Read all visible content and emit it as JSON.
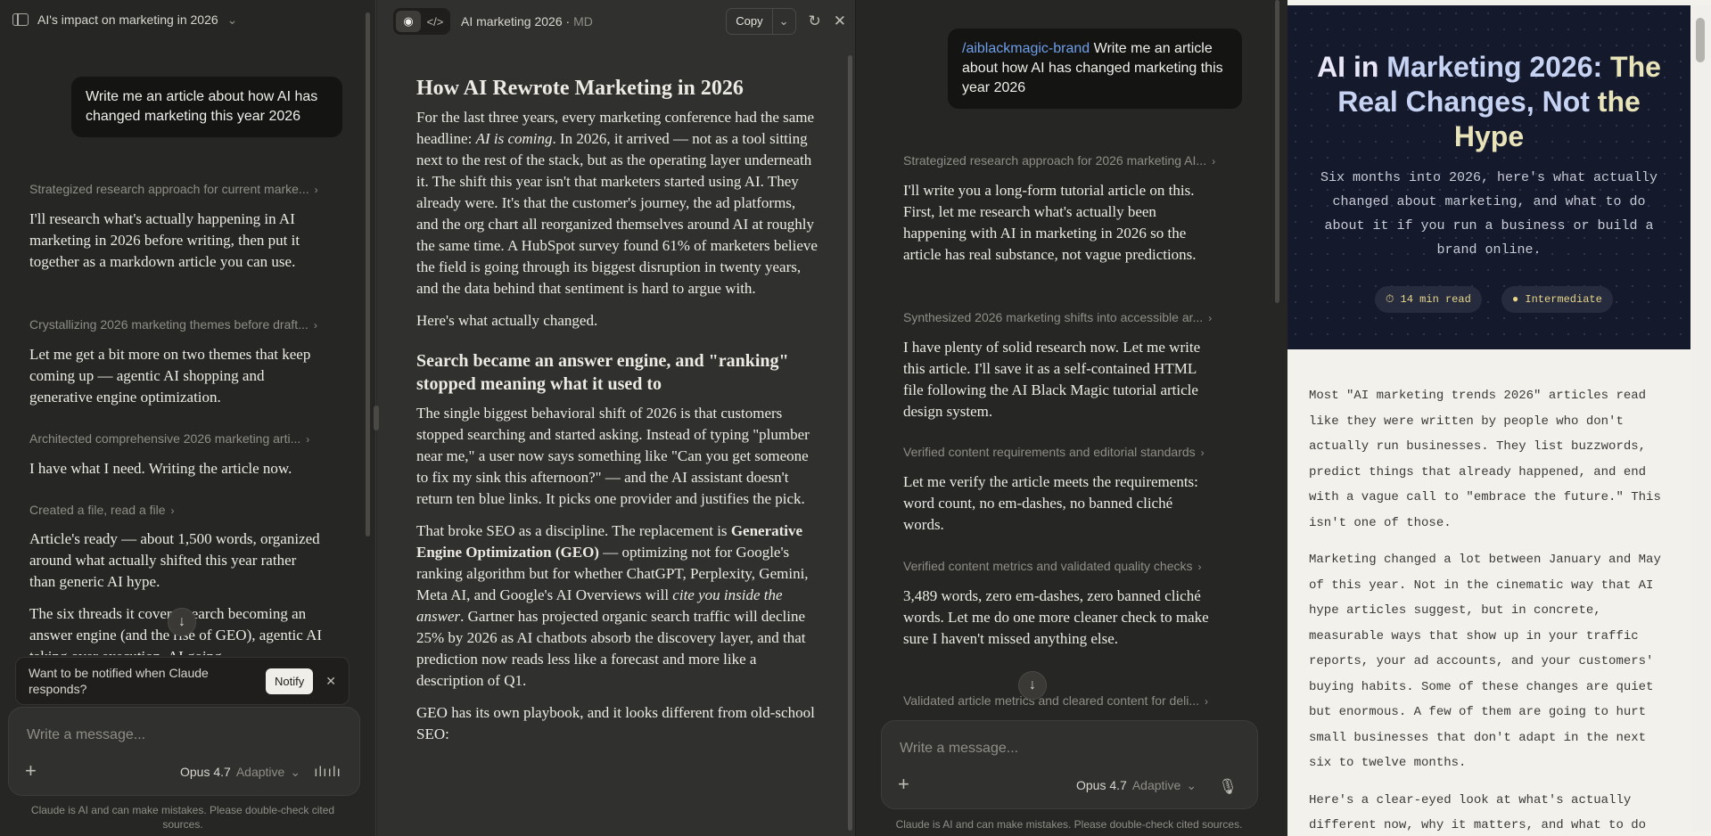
{
  "pane1": {
    "chat_title": "AI's impact on marketing in 2026",
    "user_message": "Write me an article about how AI has changed marketing this year 2026",
    "thoughts": [
      "Strategized research approach for current marke...",
      "Crystallizing 2026 marketing themes before draft...",
      "Architected comprehensive 2026 marketing arti...",
      "Created a file, read a file"
    ],
    "replies": [
      "I'll research what's actually happening in AI marketing in 2026 before writing, then put it together as a markdown article you can use.",
      "Let me get a bit more on two themes that keep coming up — agentic AI shopping and generative engine optimization.",
      "I have what I need. Writing the article now.",
      "Article's ready — about 1,500 words, organized around what actually shifted this year rather than generic AI hype.",
      "The six threads it covers: search becoming an answer engine (and the rise of GEO), agentic AI taking over execution, AI going"
    ],
    "notify_text": "Want to be notified when Claude responds?",
    "notify_button": "Notify",
    "composer_placeholder": "Write a message...",
    "model_name": "Opus 4.7",
    "model_mode": "Adaptive",
    "disclaimer": "Claude is AI and can make mistakes. Please double-check cited sources."
  },
  "pane2": {
    "file_name": "AI marketing 2026",
    "file_type": "MD",
    "copy_label": "Copy",
    "title": "How AI Rewrote Marketing in 2026",
    "para1_a": "For the last three years, every marketing conference had the same headline: ",
    "para1_em": "AI is coming",
    "para1_b": ". In 2026, it arrived — not as a tool sitting next to the rest of the stack, but as the operating layer underneath it. The shift this year isn't that marketers started using AI. They already were. It's that the customer's journey, the ad platforms, and the org chart all reorganized themselves around AI at roughly the same time. A HubSpot survey found 61% of marketers believe the field is going through its biggest disruption in twenty years, and the data behind that sentiment is hard to argue with.",
    "para2": "Here's what actually changed.",
    "h2": "Search became an answer engine, and \"ranking\" stopped meaning what it used to",
    "para3": "The single biggest behavioral shift of 2026 is that customers stopped searching and started asking. Instead of typing \"plumber near me,\" a user now says something like \"Can you get someone to fix my sink this afternoon?\" — and the AI assistant doesn't return ten blue links. It picks one provider and justifies the pick.",
    "para4_a": "That broke SEO as a discipline. The replacement is ",
    "para4_strong": "Generative Engine Optimization (GEO)",
    "para4_b": " — optimizing not for Google's ranking algorithm but for whether ChatGPT, Perplexity, Gemini, Meta AI, and Google's AI Overviews will ",
    "para4_em": "cite you inside the answer",
    "para4_c": ". Gartner has projected organic search traffic will decline 25% by 2026 as AI chatbots absorb the discovery layer, and that prediction now reads less like a forecast and more like a description of Q1.",
    "para5": "GEO has its own playbook, and it looks different from old-school SEO:"
  },
  "pane3": {
    "slash_command": "/aiblackmagic-brand",
    "user_message": "Write me an article about how AI has changed marketing this year 2026",
    "thoughts": [
      "Strategized research approach for 2026 marketing AI...",
      "Synthesized 2026 marketing shifts into accessible ar...",
      "Verified content requirements and editorial standards",
      "Verified content metrics and validated quality checks",
      "Validated article metrics and cleared content for deli..."
    ],
    "replies": [
      "I'll write you a long-form tutorial article on this. First, let me research what's actually been happening with AI in marketing in 2026 so the article has real substance, not vague predictions.",
      "I have plenty of solid research now. Let me write this article. I'll save it as a self-contained HTML file following the AI Black Magic tutorial article design system.",
      "Let me verify the article meets the requirements: word count, no em-dashes, no banned cliché words.",
      "3,489 words, zero em-dashes, zero banned cliché words. Let me do one more cleaner check to make sure I haven't missed anything else."
    ],
    "composer_placeholder": "Write a message...",
    "model_name": "Opus 4.7",
    "model_mode": "Adaptive",
    "disclaimer": "Claude is AI and can make mistakes. Please double-check cited sources."
  },
  "pane4": {
    "hero_title_1": "AI in ",
    "hero_title_2": "Marketing 2026: ",
    "hero_title_3": "The",
    "hero_title_4": "Real Changes, Not ",
    "hero_title_5": "the",
    "hero_title_6": "Hype",
    "hero_subtitle": "Six months into 2026, here's what actually changed about marketing, and what to do about it if you run a business or build a brand online.",
    "read_time": "⏱ 14 min read",
    "level": "● Intermediate",
    "para1": "Most \"AI marketing trends 2026\" articles read like they were written by people who don't actually run businesses. They list buzzwords, predict things that already happened, and end with a vague call to \"embrace the future.\" This isn't one of those.",
    "para2": "Marketing changed a lot between January and May of this year. Not in the cinematic way that AI hype articles suggest, but in concrete, measurable ways that show up in your traffic reports, your ad accounts, and your customers' buying habits. Some of these changes are quiet but enormous. A few of them are going to hurt small businesses that don't adapt in the next six to twelve months.",
    "para3": "Here's a clear-eyed look at what's actually different now, why it matters, and what to do"
  },
  "colors": {
    "accent_link": "#6e9ee8",
    "hero_bg": "#141a2c",
    "pill_text": "#e8d58a"
  }
}
